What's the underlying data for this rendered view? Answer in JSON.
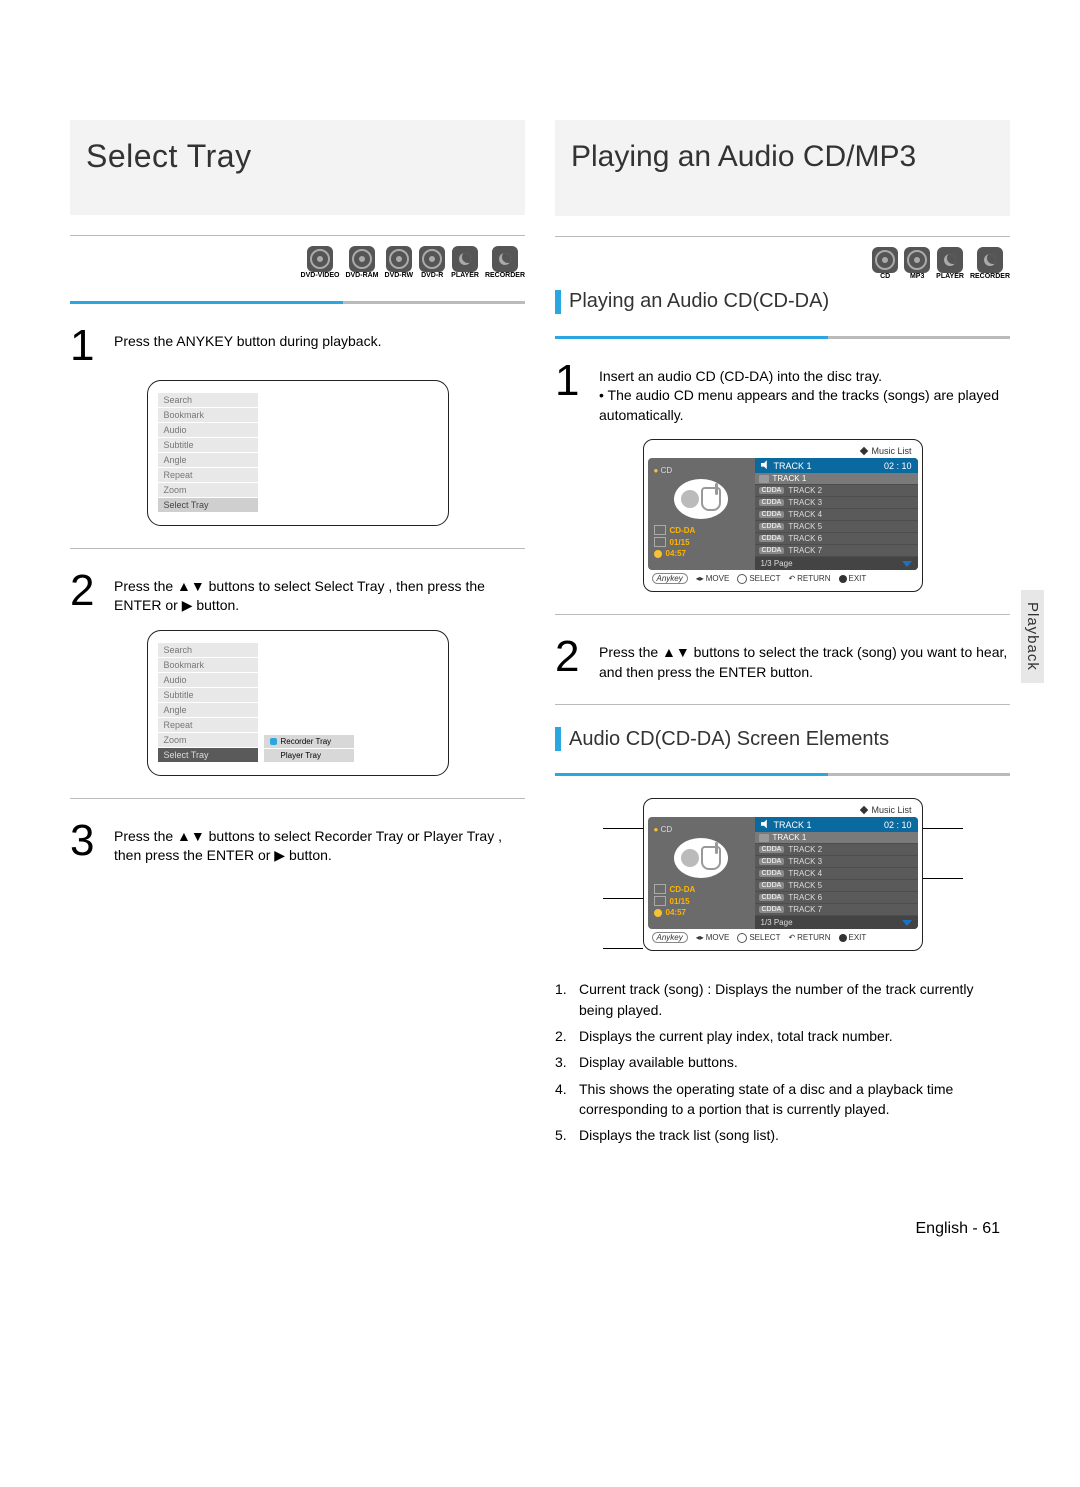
{
  "left": {
    "title": "Select Tray",
    "caps": [
      "DVD-VIDEO",
      "DVD-RAM",
      "DVD-RW",
      "DVD-R",
      "PLAYER",
      "RECORDER"
    ],
    "step1": "Press the ANYKEY button during playback.",
    "step2a": "Press the ",
    "step2b": " buttons to select Select Tray , then press the ENTER or ",
    "step2c": " button.",
    "step3a": "Press the ",
    "step3b": " buttons to select  Recorder Tray  or Player Tray , then press the ENTER or ",
    "step3c": " button.",
    "menu": [
      "Search",
      "Bookmark",
      "Audio",
      "Subtitle",
      "Angle",
      "Repeat",
      "Zoom",
      "Select Tray"
    ],
    "submenu": [
      "Recorder Tray",
      "Player Tray"
    ]
  },
  "right": {
    "title": "Playing an Audio CD/MP3",
    "caps": [
      "CD",
      "MP3",
      "PLAYER",
      "RECORDER"
    ],
    "sectionA": "Playing an Audio CD(CD-DA)",
    "sectionB": "Audio CD(CD-DA) Screen Elements",
    "step1a": "Insert an audio CD (CD-DA) into the disc tray.",
    "step1b": "• The audio CD menu appears and the tracks (songs) are played automatically.",
    "step2a": "Press the ",
    "step2b": " buttons to select the track (song) you want to hear, and then press the ENTER button.",
    "musicList": {
      "title": "Music List",
      "source": "CD",
      "current": "TRACK 1",
      "time": "02 : 10",
      "folder": "CD-DA",
      "index": "01/15",
      "elapsed": "04:57",
      "tracks": [
        "TRACK 1",
        "TRACK 2",
        "TRACK 3",
        "TRACK 4",
        "TRACK 5",
        "TRACK 6",
        "TRACK 7"
      ],
      "badge": "CDDA",
      "page": "1/3 Page",
      "footer": {
        "anykey": "Anykey",
        "move": "MOVE",
        "select": "SELECT",
        "return": "RETURN",
        "exit": "EXIT"
      }
    },
    "elements": [
      "Current track (song)  : Displays the number of the track currently being played.",
      "Displays the current play index, total track number.",
      "Display available buttons.",
      "This shows the operating state of a disc and a playback time corresponding to a portion that is currently played.",
      "Displays the track list (song list)."
    ]
  },
  "sideTab": "Playback",
  "footer": "English - 61"
}
